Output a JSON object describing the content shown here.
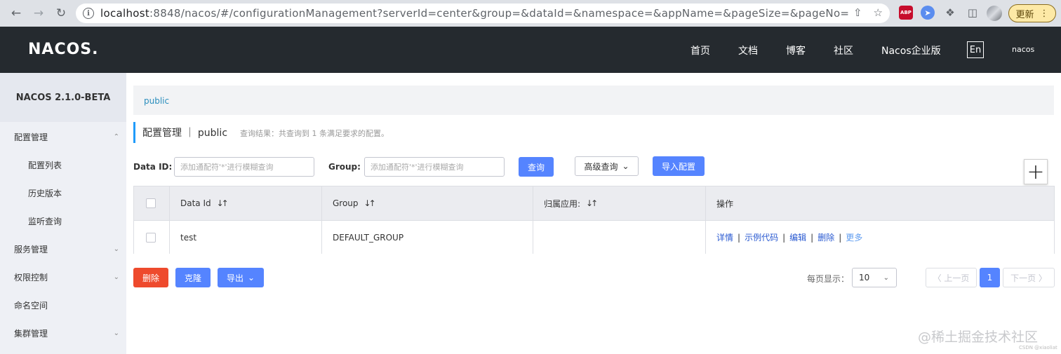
{
  "browser": {
    "url_host": "localhost",
    "url_rest": ":8848/nacos/#/configurationManagement?serverId=center&group=&dataId=&namespace=&appName=&pageSize=&pageNo=",
    "abp_label": "ABP",
    "update_label": "更新"
  },
  "header": {
    "logo": "NACOS.",
    "nav": [
      "首页",
      "文档",
      "博客",
      "社区",
      "Nacos企业版"
    ],
    "lang": "En",
    "user": "nacos"
  },
  "sidebar": {
    "version": "NACOS 2.1.0-BETA",
    "items": [
      {
        "label": "配置管理"
      },
      {
        "label": "配置列表"
      },
      {
        "label": "历史版本"
      },
      {
        "label": "监听查询"
      },
      {
        "label": "服务管理"
      },
      {
        "label": "权限控制"
      },
      {
        "label": "命名空间"
      },
      {
        "label": "集群管理"
      }
    ]
  },
  "main": {
    "breadcrumb": "public",
    "title": "配置管理 ｜ public",
    "query_result": "查询结果：共查询到 1 条满足要求的配置。",
    "data_id_label": "Data ID:",
    "data_id_placeholder": "添加通配符'*'进行模糊查询",
    "group_label": "Group:",
    "group_placeholder": "添加通配符'*'进行模糊查询",
    "query_button": "查询",
    "advanced_query": "高级查询",
    "import_button": "导入配置",
    "plus": "+"
  },
  "table": {
    "columns": [
      "Data Id",
      "Group",
      "归属应用:",
      "操作"
    ],
    "rows": [
      {
        "data_id": "test",
        "group": "DEFAULT_GROUP",
        "app": ""
      }
    ],
    "operations": [
      "详情",
      "示例代码",
      "编辑",
      "删除",
      "更多"
    ],
    "separator": "|"
  },
  "footer": {
    "delete": "删除",
    "clone": "克隆",
    "export": "导出",
    "per_page_label": "每页显示：",
    "per_page_value": "10",
    "prev": "〈 上一页",
    "current_page": "1",
    "next": "下一页 〉"
  },
  "watermark": "@稀土掘金技术社区",
  "watermark_small": "CSDN @xiaoliat",
  "colors": {
    "header_bg": "#252a2f",
    "primary": "#5584ff",
    "danger": "#ee4a2d",
    "link": "#2a5ad1",
    "sidebar_bg": "#eef0f5"
  }
}
